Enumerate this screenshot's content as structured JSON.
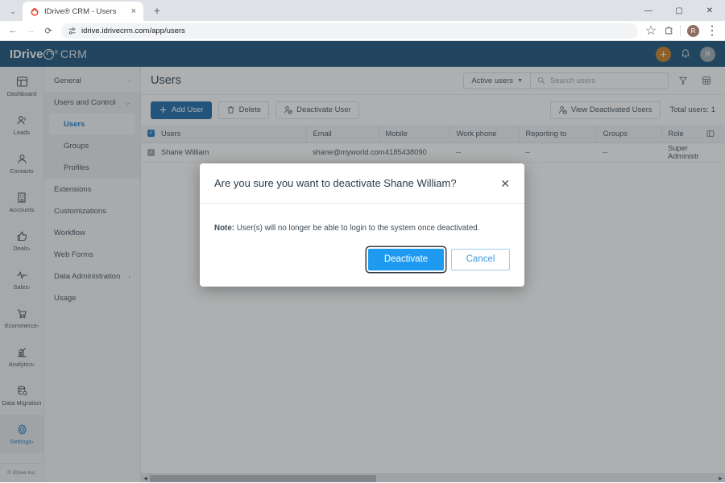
{
  "browser": {
    "tab": {
      "title": "IDrive® CRM - Users",
      "favicon": "idrive-lock-favicon",
      "close_label": "×"
    },
    "new_tab_label": "+",
    "tab_list_label": "⌄",
    "window": {
      "minimize": "—",
      "maximize": "▢",
      "close": "✕"
    },
    "nav": {
      "back": "←",
      "forward": "→",
      "reload": "⟳"
    },
    "omnibox": {
      "url": "idrive.idrivecrm.com/app/users",
      "site_icon": "site-settings-icon"
    },
    "toolbar": {
      "bookmark": "☆",
      "extensions": "extensions-icon",
      "profile_initial": "R",
      "menu": "⋮"
    }
  },
  "app_header": {
    "logo": {
      "idrive": "IDrive",
      "reg": "®",
      "crm": "CRM"
    },
    "add_button": "+",
    "notifications": "bell-icon",
    "avatar_initial": "R"
  },
  "rail": {
    "items": [
      {
        "label": "Dashboard",
        "icon": "dashboard-icon",
        "caret": "",
        "active": false
      },
      {
        "label": "Leads",
        "icon": "leads-icon",
        "caret": "",
        "active": false
      },
      {
        "label": "Contacts",
        "icon": "contacts-icon",
        "caret": "",
        "active": false
      },
      {
        "label": "Accounts",
        "icon": "accounts-icon",
        "caret": "",
        "active": false
      },
      {
        "label": "Deals",
        "icon": "deals-icon",
        "caret": "›",
        "active": false
      },
      {
        "label": "Sales",
        "icon": "sales-icon",
        "caret": "›",
        "active": false
      },
      {
        "label": "Ecommerce",
        "icon": "ecommerce-icon",
        "caret": "›",
        "active": false
      },
      {
        "label": "Analytics",
        "icon": "analytics-icon",
        "caret": "›",
        "active": false
      },
      {
        "label": "Data Migration",
        "icon": "data-migration-icon",
        "caret": "",
        "active": false
      },
      {
        "label": "Settings",
        "icon": "settings-gear-icon",
        "caret": "›",
        "active": true
      }
    ],
    "footer": "© IDrive Inc."
  },
  "sub_nav": {
    "items": [
      {
        "label": "General",
        "chev": "›"
      },
      {
        "label": "Users and Control",
        "chev": "⌄"
      }
    ],
    "children": [
      {
        "label": "Users",
        "active": true
      },
      {
        "label": "Groups",
        "active": false
      },
      {
        "label": "Profiles",
        "active": false
      }
    ],
    "rest": [
      {
        "label": "Extensions",
        "chev": ""
      },
      {
        "label": "Customizations",
        "chev": ""
      },
      {
        "label": "Workflow",
        "chev": ""
      },
      {
        "label": "Web Forms",
        "chev": ""
      },
      {
        "label": "Data Administration",
        "chev": "›"
      },
      {
        "label": "Usage",
        "chev": ""
      }
    ]
  },
  "main": {
    "page_title": "Users",
    "filter_select": "Active users",
    "search_placeholder": "Search users",
    "filter_icon": "funnel-icon",
    "grid_icon": "grid-view-icon",
    "toolbar": {
      "add_user": "Add User",
      "delete": "Delete",
      "deactivate_user": "Deactivate User",
      "view_deactivated": "View Deactivated Users",
      "total_users": "Total users: 1"
    },
    "table": {
      "columns": [
        "Users",
        "Email",
        "Mobile",
        "Work phone",
        "Reporting to",
        "Groups",
        "Role"
      ],
      "column_settings_icon": "column-settings-icon",
      "header_checkbox_checked": true,
      "rows": [
        {
          "checked": true,
          "name": "Shane William",
          "email": "shane@myworld.com",
          "mobile": "4185438090",
          "work_phone": "--",
          "reporting_to": "--",
          "groups": "--",
          "role": "Super Administr"
        }
      ]
    },
    "scrollbar": {
      "left_arrow": "◀",
      "right_arrow": "▶"
    }
  },
  "modal": {
    "title": "Are you sure you want to deactivate Shane William?",
    "close": "✕",
    "note_label": "Note:",
    "note_text": " User(s) will no longer be able to login to the system once deactivated.",
    "confirm": "Deactivate",
    "cancel": "Cancel"
  },
  "colors": {
    "app_header": "#104a74",
    "primary_button": "#1263a5",
    "modal_confirm": "#1e9bf0",
    "accent_add": "#c8791a",
    "active_nav": "#1477c4"
  }
}
